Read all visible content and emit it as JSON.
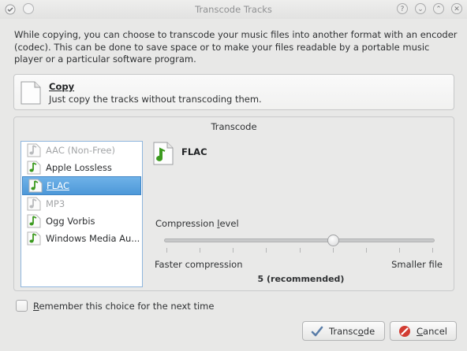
{
  "window": {
    "title": "Transcode Tracks",
    "buttons": [
      "?",
      "⌄",
      "⌃",
      "✕"
    ]
  },
  "description": "While copying, you can choose to transcode your music files into another format with an encoder (codec). This can be done to save space or to make your files readable by a portable music player or a particular software program.",
  "copy_option": {
    "title": "Copy",
    "subtitle": "Just copy the tracks without transcoding them."
  },
  "transcode": {
    "group_title": "Transcode",
    "codecs": [
      {
        "label": "AAC (Non-Free)",
        "disabled": true
      },
      {
        "label": "Apple Lossless",
        "disabled": false
      },
      {
        "label": "FLAC",
        "disabled": false,
        "selected": true
      },
      {
        "label": "MP3",
        "disabled": true
      },
      {
        "label": "Ogg Vorbis",
        "disabled": false
      },
      {
        "label": "Windows Media Au...",
        "disabled": false
      }
    ],
    "selected_codec": "FLAC",
    "compression_label": "Compression level",
    "slider_min_label": "Faster compression",
    "slider_max_label": "Smaller file",
    "slider_value_text": "5 (recommended)",
    "slider_value": 5,
    "slider_min": 0,
    "slider_max": 8
  },
  "remember_label": "Remember this choice for the next time",
  "remember_checked": false,
  "buttons": {
    "transcode": "Transcode",
    "cancel": "Cancel"
  },
  "icons": {
    "app": "transcode-app-icon",
    "document": "document-icon",
    "music": "music-note-icon",
    "ok": "checkmark-icon",
    "cancel": "cancel-icon"
  },
  "colors": {
    "selection": "#4d98d8",
    "note_green": "#3c9a1f",
    "cancel_red": "#d23c32"
  }
}
